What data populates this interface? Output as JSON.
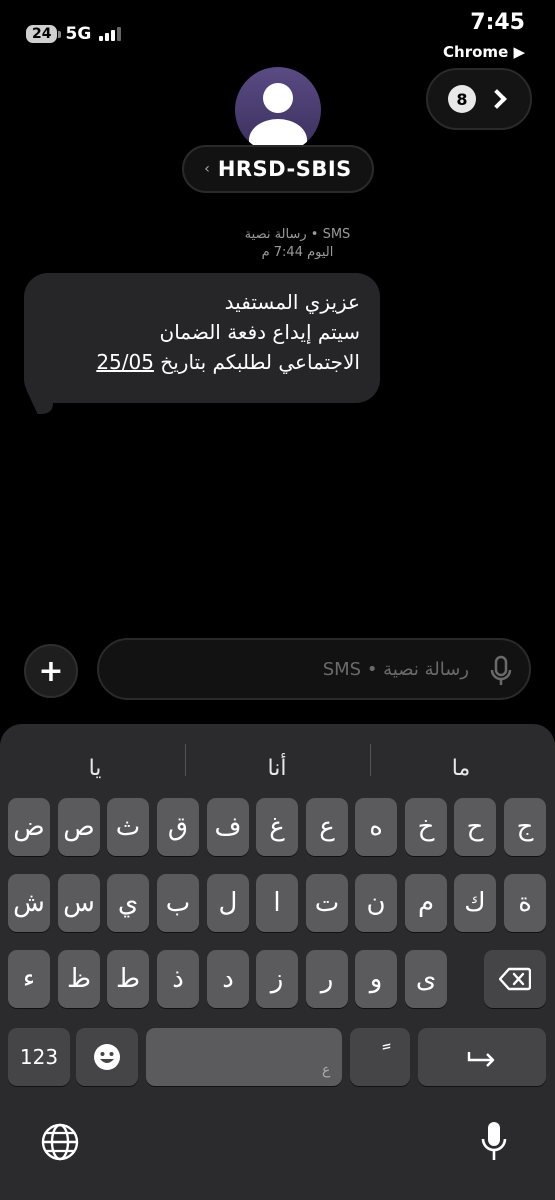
{
  "status_bar": {
    "battery": "24",
    "network": "5G",
    "time": "7:45",
    "back_app": "Chrome ▶"
  },
  "header": {
    "unread_count": "8",
    "contact_name": "HRSD-SBIS",
    "contact_chevron": "‹"
  },
  "message": {
    "meta_type": "رسالة نصية • SMS",
    "meta_time": "اليوم 7:44 م",
    "line1": "عزيزي المستفيد",
    "line2": "سيتم إيداع دفعة الضمان",
    "line3_text": "الاجتماعي لطلبكم بتاريخ ",
    "line3_date": "25/05"
  },
  "composer": {
    "plus_label": "+",
    "placeholder": "رسالة نصية • SMS"
  },
  "keyboard": {
    "suggestions": [
      "يا",
      "أنا",
      "ما"
    ],
    "row1": [
      "ض",
      "ص",
      "ث",
      "ق",
      "ف",
      "غ",
      "ع",
      "ه",
      "خ",
      "ح",
      "ج"
    ],
    "row2": [
      "ش",
      "س",
      "ي",
      "ب",
      "ل",
      "ا",
      "ت",
      "ن",
      "م",
      "ك",
      "ة"
    ],
    "row3": [
      "ء",
      "ظ",
      "ط",
      "ذ",
      "د",
      "ز",
      "ر",
      "و",
      "ى"
    ],
    "numbers_key": "123",
    "space_hint": "ع",
    "diacritic_key": "ً"
  }
}
